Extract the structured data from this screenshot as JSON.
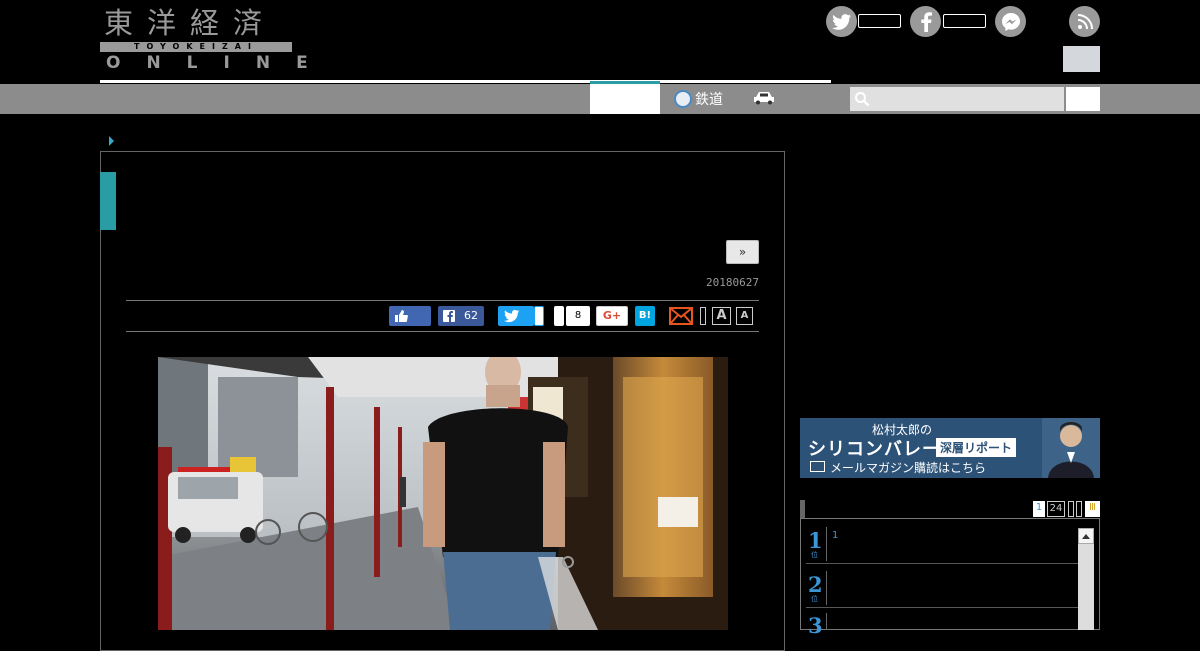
{
  "logo": {
    "kanji": "東洋経済",
    "band": "TOYOKEIZAI",
    "online": "ONLINE"
  },
  "nav": {
    "rail_label": "鉄道"
  },
  "search": {
    "placeholder": ""
  },
  "article": {
    "next_label": "»",
    "date": "20180627"
  },
  "share": {
    "facebook_count": "62",
    "pocket_count": "8",
    "gplus_label": "G+",
    "hatena_label": "B!",
    "font_large": "A",
    "font_small": "A"
  },
  "banner": {
    "line1": "松村太郎の",
    "line2": "シリコンバレー",
    "line2_box": "深層リポート",
    "line3": "メールマガジン購読はこちら"
  },
  "ranking": {
    "tabs": [
      "1",
      "24",
      "",
      "",
      "Ⅲ"
    ],
    "items": [
      {
        "rank": "1",
        "sub": "位",
        "text": "1"
      },
      {
        "rank": "2",
        "sub": "位",
        "text": ""
      },
      {
        "rank": "3",
        "sub": "位",
        "text": ""
      }
    ]
  },
  "colors": {
    "accent": "#2a9da4",
    "nav_bg": "#8c8c8c",
    "banner_bg": "#2d5277",
    "rank_blue": "#3a96d6"
  },
  "icons": [
    "twitter-icon",
    "facebook-icon",
    "messenger-icon",
    "rss-icon",
    "search-icon",
    "rail-icon",
    "car-icon",
    "mail-icon",
    "like-icon",
    "font-size-icon"
  ]
}
